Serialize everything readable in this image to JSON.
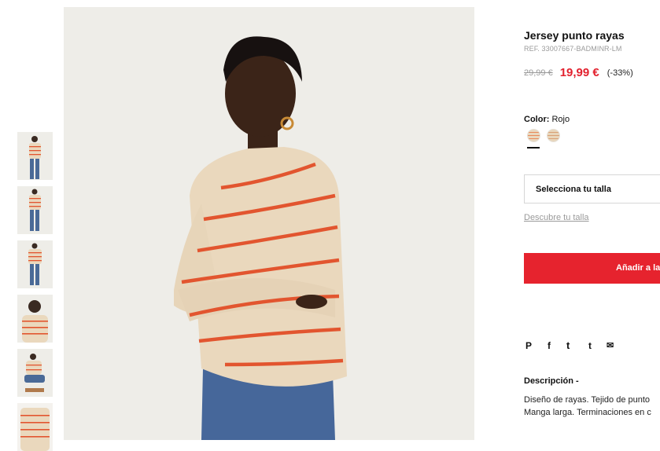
{
  "product": {
    "title": "Jersey punto rayas",
    "ref": "REF. 33007667-BADMINR-LM",
    "old_price": "29,99 €",
    "new_price": "19,99 €",
    "discount": "(-33%)",
    "color_label": "Color:",
    "color_value": "Rojo",
    "size_select_label": "Selecciona tu talla",
    "size_guide_link": "Descubre tu talla",
    "add_to_cart_label": "Añadir a la",
    "description_title": "Descripción -",
    "description_lines": [
      "Diseño de rayas. Tejido de punto",
      "Manga larga. Terminaciones en c"
    ]
  },
  "colors": {
    "accent": "#e6232e",
    "price": "#e2212e",
    "muted": "#9a9a9a",
    "sweater": "#e9d8bf",
    "stripe": "#e2552f",
    "jeans": "#4a6a97"
  },
  "share_icons": [
    "pinterest-icon",
    "facebook-icon",
    "twitter-icon",
    "tumblr-icon",
    "email-icon"
  ],
  "share_glyphs": [
    "P",
    "f",
    "t",
    "t",
    "✉"
  ],
  "thumbnails": [
    "full-body-front",
    "full-body-side",
    "full-body-back",
    "portrait-crouch",
    "sitting-pose",
    "sweater-detail"
  ]
}
